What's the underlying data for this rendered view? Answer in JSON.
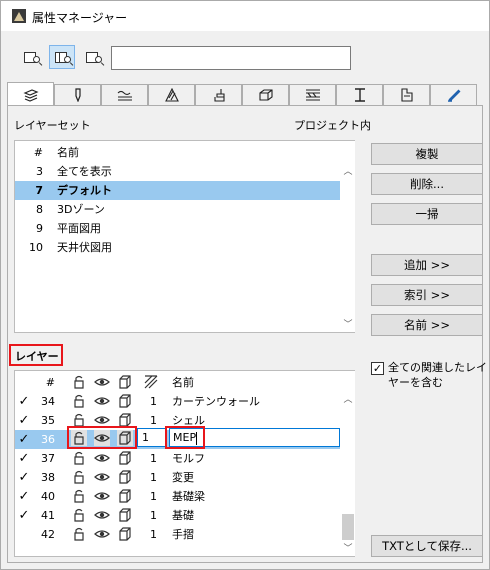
{
  "window": {
    "title": "属性マネージャー"
  },
  "toolbar": {
    "buttons": [
      {
        "icon": "open-file-icon",
        "active": false
      },
      {
        "icon": "compare-files-icon",
        "active": true
      },
      {
        "icon": "find-file-icon",
        "active": false
      }
    ],
    "search_value": ""
  },
  "tabs": [
    {
      "icon": "layers-tab-icon",
      "active": true
    },
    {
      "icon": "pens-tab-icon",
      "active": false
    },
    {
      "icon": "line-types-tab-icon",
      "active": false
    },
    {
      "icon": "fills-tab-icon",
      "active": false
    },
    {
      "icon": "surfaces-tab-icon",
      "active": false
    },
    {
      "icon": "building-materials-tab-icon",
      "active": false
    },
    {
      "icon": "composites-tab-icon",
      "active": false
    },
    {
      "icon": "profiles-tab-icon",
      "active": false
    },
    {
      "icon": "zone-categories-tab-icon",
      "active": false
    },
    {
      "icon": "renovation-filters-tab-icon",
      "active": false
    }
  ],
  "layer_sets": {
    "section_label": "レイヤーセット",
    "project_label": "プロジェクト内",
    "col_num": "#",
    "col_name": "名前",
    "rows": [
      {
        "num": "3",
        "name": "全てを表示",
        "selected": false
      },
      {
        "num": "7",
        "name": "デフォルト",
        "selected": true
      },
      {
        "num": "8",
        "name": "3Dゾーン",
        "selected": false
      },
      {
        "num": "9",
        "name": "平面図用",
        "selected": false
      },
      {
        "num": "10",
        "name": "天井伏図用",
        "selected": false
      }
    ]
  },
  "buttons": {
    "duplicate": "複製",
    "delete": "削除...",
    "purge": "一掃",
    "add": "追加 >>",
    "index": "索引 >>",
    "name": "名前 >>",
    "save_txt": "TXTとして保存..."
  },
  "layers": {
    "section_label": "レイヤー",
    "col_num": "#",
    "col_name": "名前",
    "rows": [
      {
        "num": "34",
        "checked": true,
        "intersect": "1",
        "name": "カーテンウォール"
      },
      {
        "num": "35",
        "checked": true,
        "intersect": "1",
        "name": "シェル"
      },
      {
        "num": "36",
        "checked": true,
        "intersect": "1",
        "name": "MEP",
        "editing": true
      },
      {
        "num": "37",
        "checked": true,
        "intersect": "1",
        "name": "モルフ"
      },
      {
        "num": "38",
        "checked": true,
        "intersect": "1",
        "name": "変更"
      },
      {
        "num": "40",
        "checked": true,
        "intersect": "1",
        "name": "基礎梁"
      },
      {
        "num": "41",
        "checked": true,
        "intersect": "1",
        "name": "基礎"
      },
      {
        "num": "42",
        "checked": false,
        "intersect": "1",
        "name": "手摺"
      }
    ],
    "include_related": {
      "checked": true,
      "label_line1": "全ての関連したレイ",
      "label_line2": "ヤーを含む"
    }
  },
  "glyphs": {
    "check": "✓",
    "scroll_up": "︿",
    "scroll_down": "﹀"
  },
  "colors": {
    "selection": "#99c9ef",
    "highlight_red": "#e8161b",
    "edit_border": "#0078d7"
  }
}
